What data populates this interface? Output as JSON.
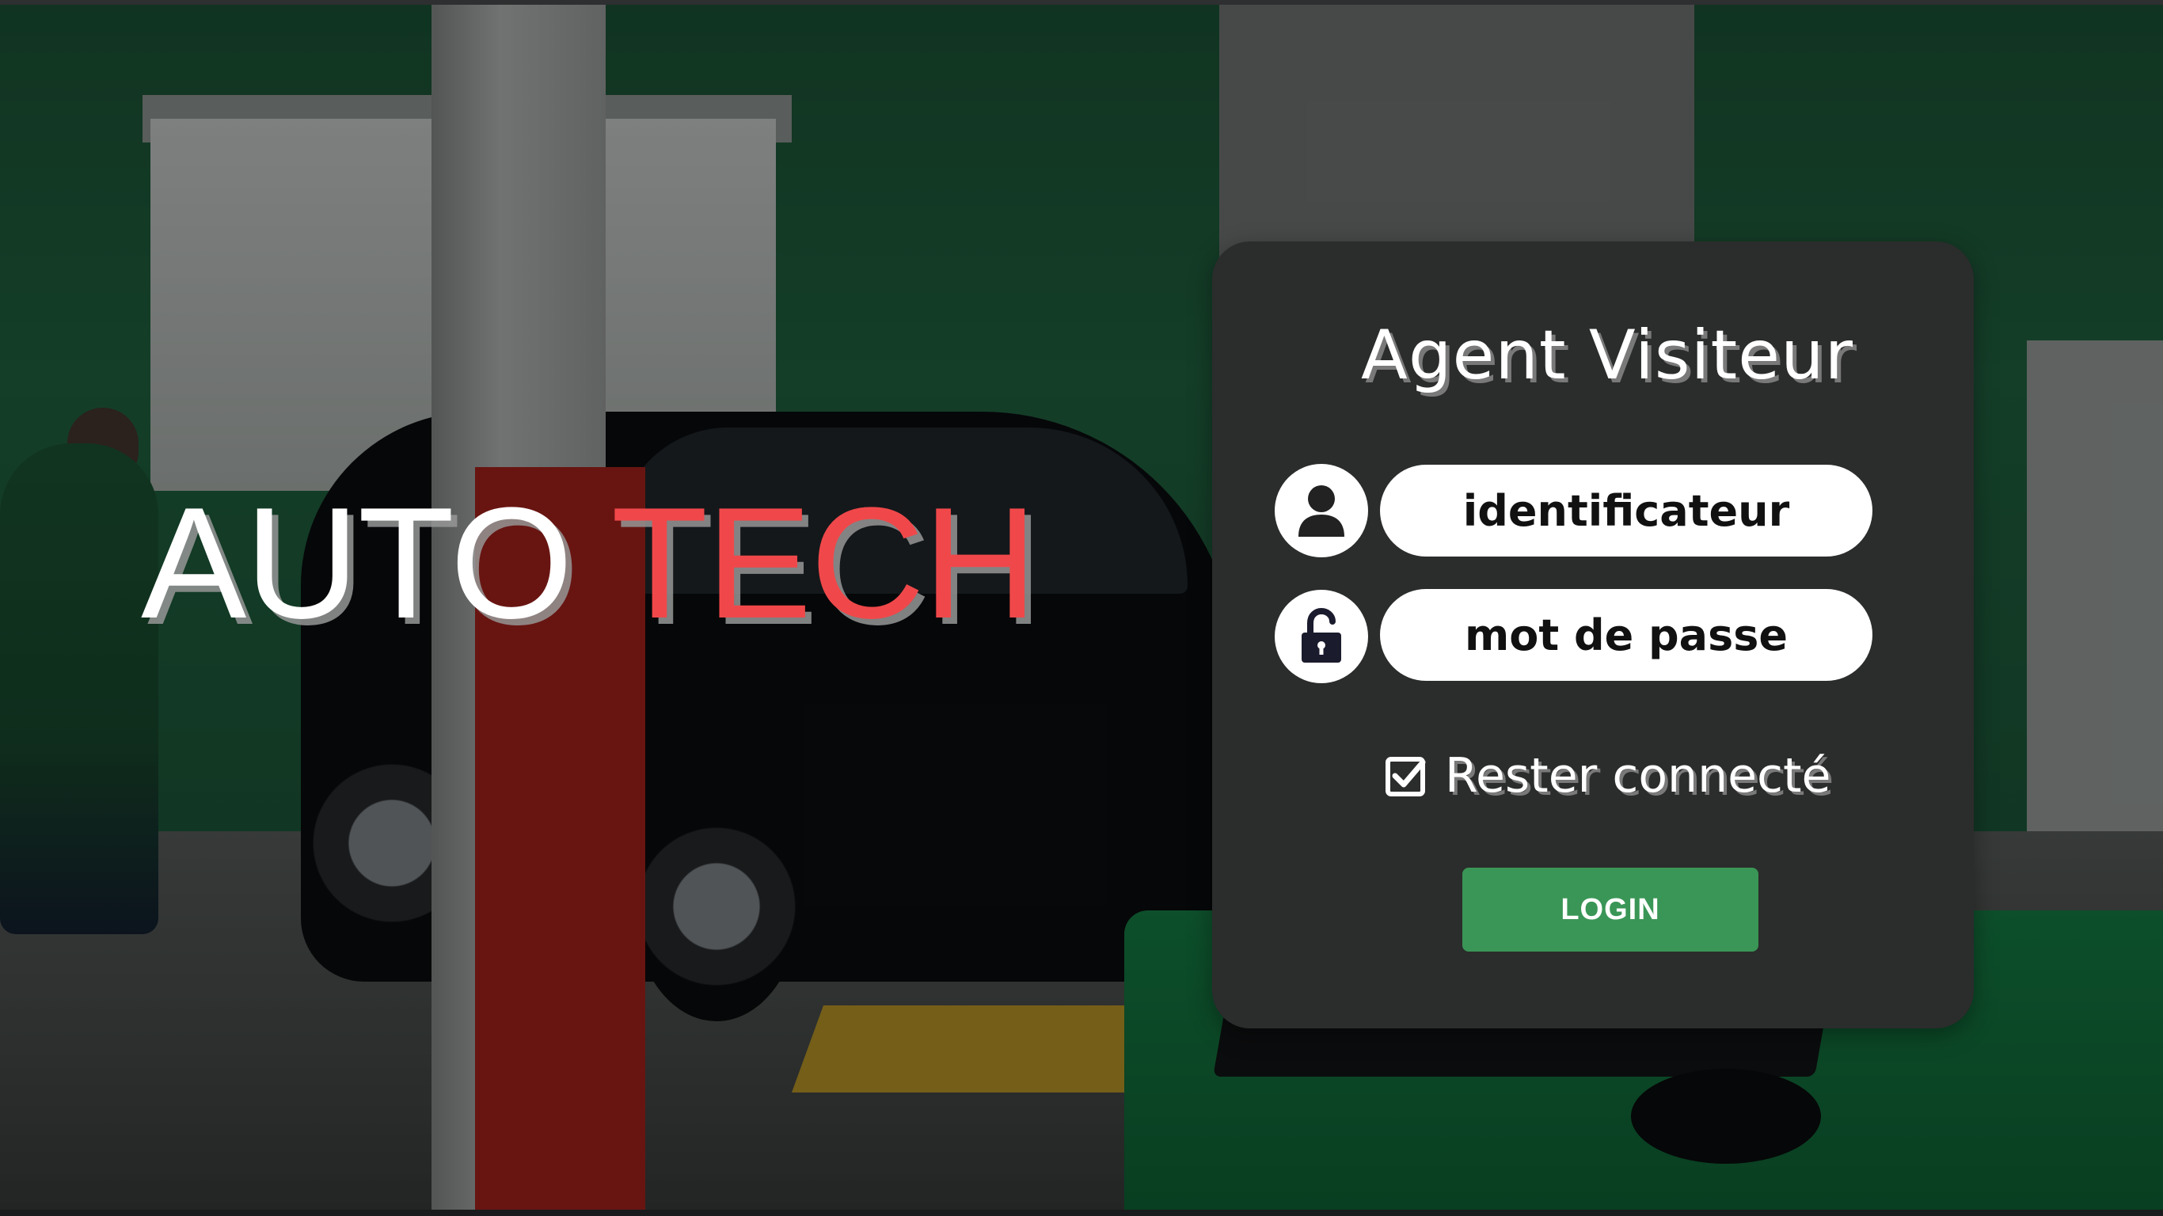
{
  "brand": {
    "part1": "AUTO",
    "part2": "TECH"
  },
  "login_card": {
    "title": "Agent Visiteur",
    "identifier_placeholder": "identificateur",
    "password_placeholder": "mot de passe",
    "remember_label": "Rester connecté",
    "remember_checked": true,
    "login_label": "LOGIN"
  },
  "icons": {
    "identifier": "user-icon",
    "password": "unlock-icon",
    "remember": "checkbox-checked-icon"
  },
  "colors": {
    "brand_accent": "#f0484a",
    "card_background": "#2b2c2c",
    "login_button": "#3a9656"
  }
}
